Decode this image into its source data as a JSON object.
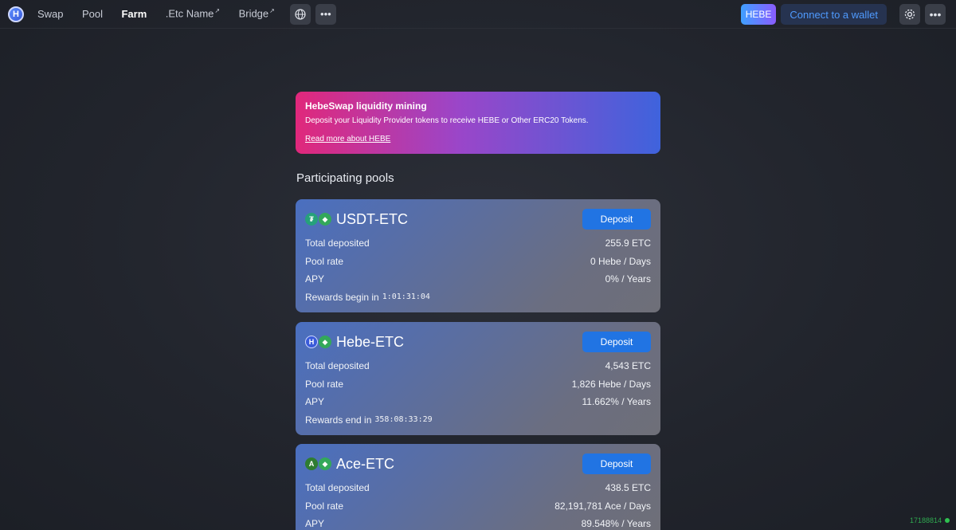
{
  "header": {
    "nav": [
      "Swap",
      "Pool",
      "Farm",
      ".Etc Name",
      "Bridge"
    ],
    "hebe_label": "HEBE",
    "connect_label": "Connect to a wallet"
  },
  "banner": {
    "title": "HebeSwap liquidity mining",
    "description": "Deposit your Liquidity Provider tokens to receive HEBE or Other ERC20 Tokens.",
    "link": "Read more about HEBE"
  },
  "section_title": "Participating pools",
  "pools": [
    {
      "name": "USDT-ETC",
      "deposit_label": "Deposit",
      "total_label": "Total deposited",
      "total_value": "255.9 ETC",
      "rate_label": "Pool rate",
      "rate_value": "0 Hebe / Days",
      "apy_label": "APY",
      "apy_value": "0% / Years",
      "rewards_label": "Rewards begin in",
      "rewards_timer": "1:01:31:04"
    },
    {
      "name": "Hebe-ETC",
      "deposit_label": "Deposit",
      "total_label": "Total deposited",
      "total_value": "4,543 ETC",
      "rate_label": "Pool rate",
      "rate_value": "1,826 Hebe / Days",
      "apy_label": "APY",
      "apy_value": "11.662% / Years",
      "rewards_label": "Rewards end in",
      "rewards_timer": "358:08:33:29"
    },
    {
      "name": "Ace-ETC",
      "deposit_label": "Deposit",
      "total_label": "Total deposited",
      "total_value": "438.5 ETC",
      "rate_label": "Pool rate",
      "rate_value": "82,191,781 Ace / Days",
      "apy_label": "APY",
      "apy_value": "89.548% / Years"
    }
  ],
  "block_number": "17188814"
}
